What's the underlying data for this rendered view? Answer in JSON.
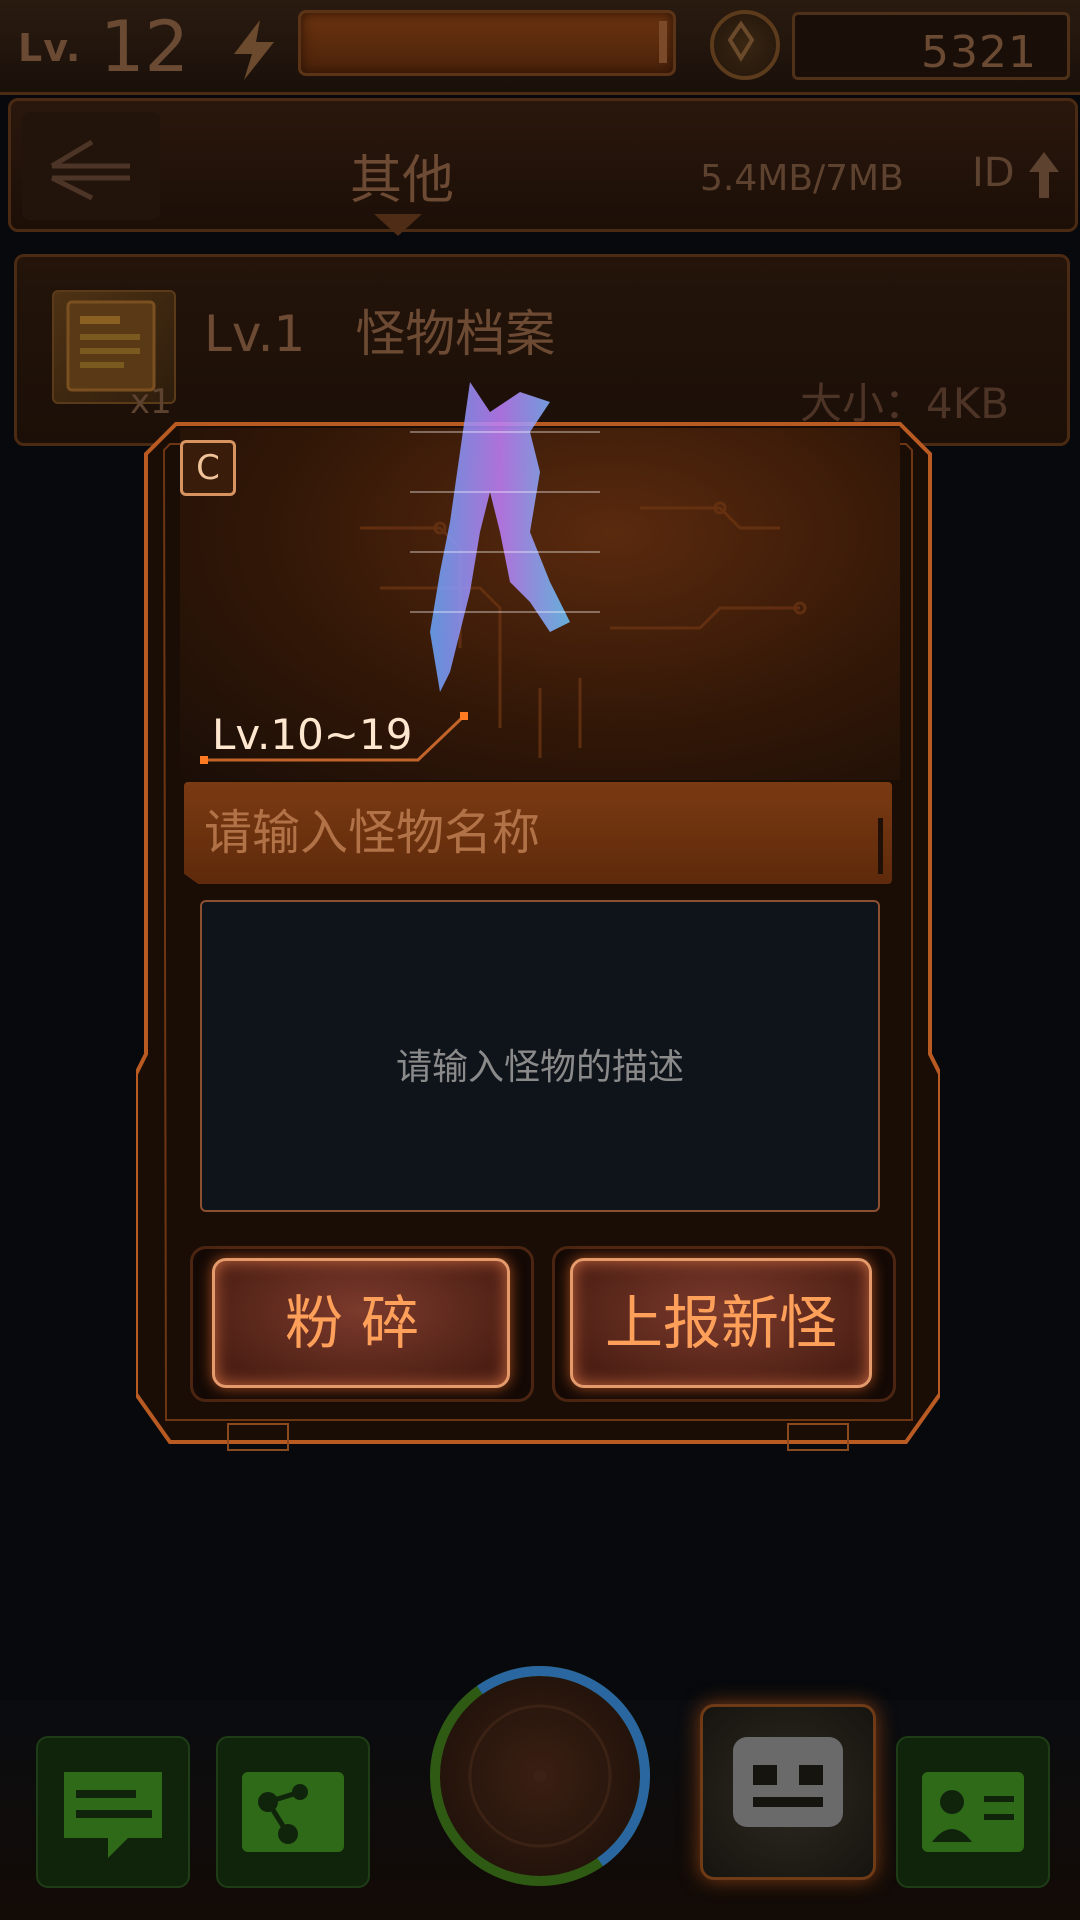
{
  "status_bar": {
    "level_label": "Lv.",
    "level_value": "12",
    "coins": "5321"
  },
  "category": {
    "title": "其他",
    "storage": "5.4MB/7MB",
    "sort_label": "ID"
  },
  "list_item": {
    "name": "Lv.1　怪物档案",
    "quantity": "x1",
    "size": "大小：4KB"
  },
  "modal": {
    "rank": "C",
    "level_range": "Lv.10~19",
    "name_placeholder": "请输入怪物名称",
    "description_placeholder": "请输入怪物的描述",
    "smash_label": "粉碎",
    "report_label": "上报新怪"
  },
  "icons": {
    "back": "back-arrow-icon",
    "sort_up": "arrow-up-icon",
    "energy": "lightning-icon",
    "coin": "coin-icon",
    "nav": [
      "chat-icon",
      "network-icon",
      "radar-icon",
      "monster-file-icon",
      "contacts-icon"
    ]
  },
  "colors": {
    "accent": "#ff9a52",
    "frame": "#c7642c",
    "nav_green": "#2f5a14"
  }
}
